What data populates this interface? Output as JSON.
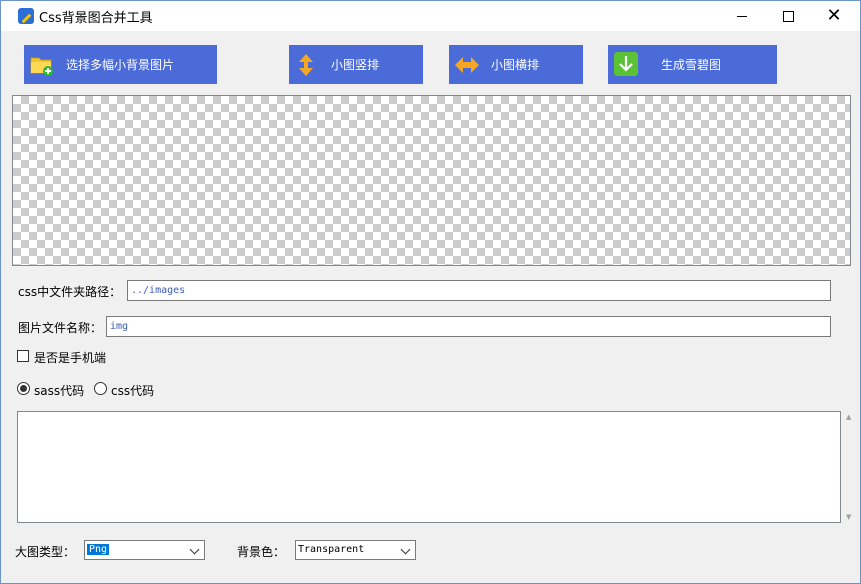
{
  "window": {
    "title": "Css背景图合并工具",
    "minimize_glyph": "—",
    "maximize_glyph": "☐",
    "close_glyph": "✕"
  },
  "toolbar": {
    "select_images": "选择多幅小背景图片",
    "stack_vertical": "小图竖排",
    "stack_horizontal": "小图横排",
    "generate_sprite": "生成雪碧图"
  },
  "form": {
    "css_folder_label": "css中文件夹路径：",
    "css_folder_value": "../images",
    "image_name_label": "图片文件名称：",
    "image_name_value": "img",
    "mobile_label": "是否是手机端",
    "mobile_checked": false,
    "code_type_options": [
      "sass代码",
      "css代码"
    ],
    "code_type_selected": "sass代码",
    "code_output": "",
    "image_type_label": "大图类型：",
    "image_type_value": "Png",
    "bg_color_label": "背景色：",
    "bg_color_value": "Transparent"
  },
  "icons": {
    "select_images": "folder-add-icon",
    "stack_vertical": "arrow-up-down-icon",
    "stack_horizontal": "arrow-left-right-icon",
    "generate_sprite": "download-arrow-icon"
  },
  "colors": {
    "toolbar_button_bg": "#4b6bd8",
    "text_value": "#3b5bb5",
    "selection": "#0078d7",
    "window_border": "#6a94c8"
  }
}
